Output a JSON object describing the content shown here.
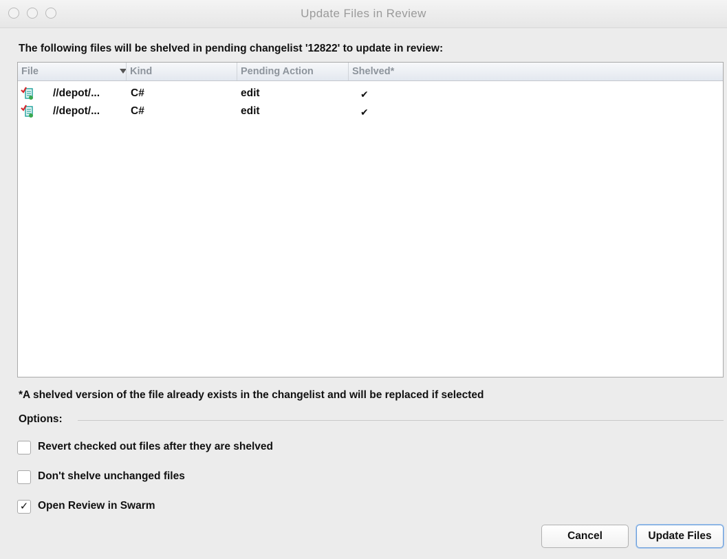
{
  "window": {
    "title": "Update Files in Review"
  },
  "heading": "The following files will be shelved in pending changelist '12822' to update in review:",
  "table": {
    "columns": {
      "file": "File",
      "kind": "Kind",
      "pending_action": "Pending Action",
      "shelved": "Shelved*"
    },
    "sort_icon": "sort-descending-icon",
    "rows": [
      {
        "file": "//depot/...",
        "kind": "C#",
        "pending_action": "edit",
        "shelved": "✔",
        "icon": "checked-out-file-icon"
      },
      {
        "file": "//depot/...",
        "kind": "C#",
        "pending_action": "edit",
        "shelved": "✔",
        "icon": "checked-out-file-icon"
      }
    ]
  },
  "footnote": "*A shelved version of the file already exists in the changelist and will be replaced if selected",
  "options": {
    "label": "Options:",
    "items": [
      {
        "label": "Revert checked out files after they are shelved",
        "checked": false,
        "mark": ""
      },
      {
        "label": "Don't shelve unchanged files",
        "checked": false,
        "mark": ""
      },
      {
        "label": "Open Review in Swarm",
        "checked": true,
        "mark": "✓"
      }
    ]
  },
  "buttons": {
    "cancel": "Cancel",
    "update_files": "Update Files"
  },
  "colors": {
    "check_red": "#d8262c",
    "doc_teal": "#2aa6a0",
    "default_button_border": "#6d9fd8"
  }
}
